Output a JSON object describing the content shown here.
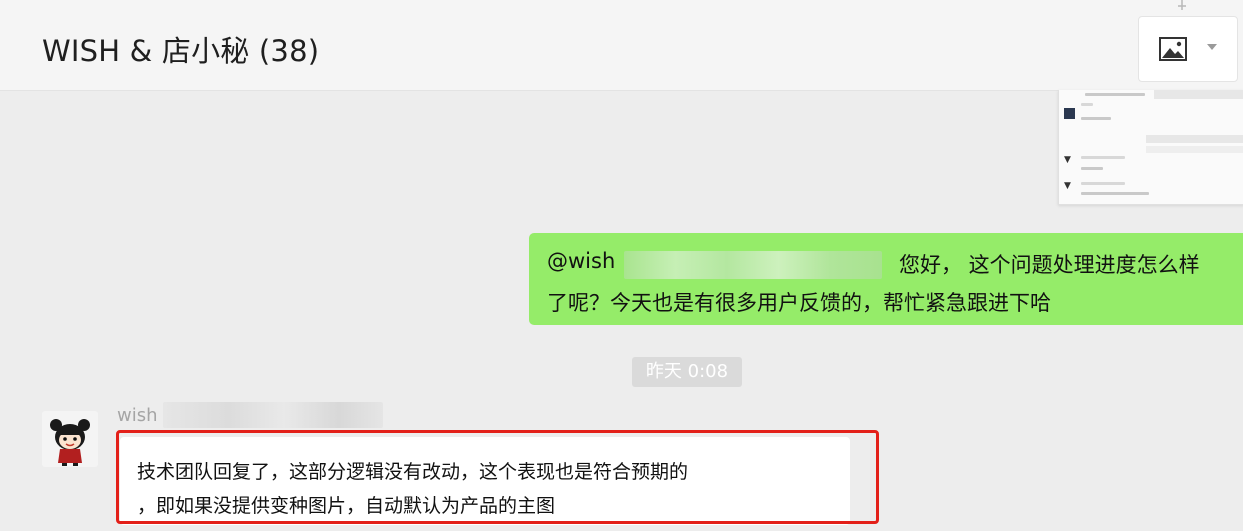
{
  "header": {
    "title": "WISH & 店小秘 (38)",
    "image_button_icon": "picture-icon",
    "dropdown_icon": "chevron-down-icon",
    "pin_icon": "pin-icon"
  },
  "messages": [
    {
      "direction": "outgoing",
      "mention": "@wish",
      "line1_after": "您好， 这个问题处理进度怎么样",
      "line2": "了呢？今天也是有很多用户反馈的，帮忙紧急跟进下哈"
    },
    {
      "direction": "incoming",
      "sender": "wish",
      "line1": "技术团队回复了，这部分逻辑没有改动，这个表现也是符合预期的",
      "line2": "，即如果没提供变种图片，自动默认为产品的主图"
    }
  ],
  "timestamp": "昨天 0:08",
  "colors": {
    "outgoing_bubble": "#95ec69",
    "incoming_bubble": "#ffffff",
    "highlight_border": "#e32019",
    "background": "#ededed"
  }
}
